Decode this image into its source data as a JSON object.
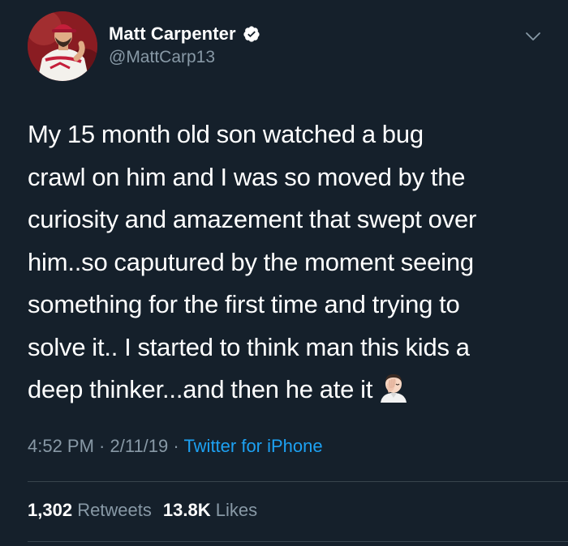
{
  "author": {
    "display_name": "Matt Carpenter",
    "handle": "@MattCarp13",
    "verified": true,
    "verified_icon": "verified-badge-icon"
  },
  "tweet": {
    "lines": [
      "My 15 month old son watched a bug",
      "crawl on him and I was so moved by the",
      "curiosity and amazement that swept over",
      "him..so caputured by the moment seeing",
      "something for the first time and trying to",
      "solve it.. I started to think man this kids a",
      "deep thinker...and then he ate it"
    ],
    "trailing_emoji": "facepalm-emoji"
  },
  "meta": {
    "time": "4:52 PM",
    "sep1": " · ",
    "date": "2/11/19",
    "sep2": " · ",
    "source": "Twitter for iPhone"
  },
  "stats": {
    "retweets_count": "1,302",
    "retweets_label": "Retweets",
    "likes_count": "13.8K",
    "likes_label": "Likes"
  },
  "colors": {
    "background": "#15202b",
    "text_primary": "#ffffff",
    "text_secondary": "#8899a6",
    "accent": "#1da1f2",
    "divider": "#38444d"
  }
}
